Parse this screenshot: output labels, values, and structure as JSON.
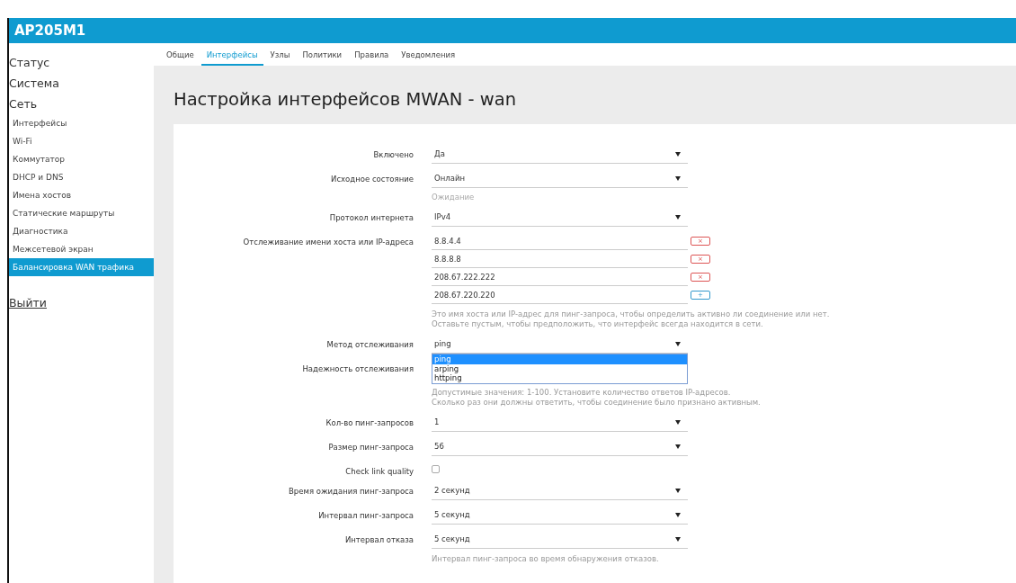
{
  "header": {
    "title": "AP205M1"
  },
  "sidebar": {
    "items": [
      {
        "label": "Статус",
        "selected": false
      },
      {
        "label": "Система",
        "selected": false
      },
      {
        "label": "Сеть",
        "selected": false,
        "children": [
          {
            "label": "Интерфейсы",
            "selected": false
          },
          {
            "label": "Wi-Fi",
            "selected": false
          },
          {
            "label": "Коммутатор",
            "selected": false
          },
          {
            "label": "DHCP и DNS",
            "selected": false
          },
          {
            "label": "Имена хостов",
            "selected": false
          },
          {
            "label": "Статические маршруты",
            "selected": false
          },
          {
            "label": "Диагностика",
            "selected": false
          },
          {
            "label": "Межсетевой экран",
            "selected": false
          },
          {
            "label": "Балансировка WAN трафика",
            "selected": true
          }
        ]
      }
    ],
    "logout": "Выйти"
  },
  "tabs": [
    {
      "label": "Общие",
      "selected": false
    },
    {
      "label": "Интерфейсы",
      "selected": true
    },
    {
      "label": "Узлы",
      "selected": false
    },
    {
      "label": "Политики",
      "selected": false
    },
    {
      "label": "Правила",
      "selected": false
    },
    {
      "label": "Уведомления",
      "selected": false
    }
  ],
  "page_title": "Настройка интерфейсов MWAN - wan",
  "form": {
    "rows": [
      {
        "kind": "select",
        "label": "Включено",
        "value": "Да"
      },
      {
        "kind": "select",
        "label": "Исходное состояние",
        "value": "Онлайн",
        "note": "Ожидание"
      },
      {
        "kind": "select",
        "label": "Протокол интернета",
        "value": "IPv4"
      },
      {
        "kind": "host_list",
        "label": "Отслеживание имени хоста или IP-адреса",
        "entries": [
          {
            "value": "8.8.4.4",
            "button": {
              "kind": "remove",
              "label": "×"
            }
          },
          {
            "value": "8.8.8.8",
            "button": {
              "kind": "remove",
              "label": "×"
            }
          },
          {
            "value": "208.67.222.222",
            "button": {
              "kind": "remove",
              "label": "×"
            }
          },
          {
            "value": "208.67.220.220",
            "button": {
              "kind": "add",
              "label": "+"
            }
          }
        ],
        "hint": [
          "Это имя хоста или IP-адрес для пинг-запроса, чтобы определить активно ли соединение или нет.",
          "Оставьте пустым, чтобы предположить, что интерфейс всегда находится в сети."
        ]
      },
      {
        "kind": "select",
        "label": "Метод отслеживания",
        "value": "ping",
        "expanded": true,
        "options": [
          {
            "label": "ping",
            "selected": true
          },
          {
            "label": "arping",
            "selected": false
          },
          {
            "label": "httping",
            "selected": false
          }
        ]
      },
      {
        "kind": "hidden",
        "label": "Надежность отслеживания",
        "hint": [
          "Допустимые значения: 1-100. Установите количество ответов IP-адресов.",
          "Сколько раз они должны ответить, чтобы соединение было признано активным."
        ]
      },
      {
        "kind": "select",
        "label": "Кол-во пинг-запросов",
        "value": "1"
      },
      {
        "kind": "select",
        "label": "Размер пинг-запроса",
        "value": "56"
      },
      {
        "kind": "checkbox",
        "label": "Check link quality",
        "checked": false
      },
      {
        "kind": "select",
        "label": "Время ожидания пинг-запроса",
        "value": "2 секунд"
      },
      {
        "kind": "select",
        "label": "Интервал пинг-запроса",
        "value": "5 секунд"
      },
      {
        "kind": "select",
        "label": "Интервал отказа",
        "value": "5 секунд",
        "hint": [
          "Интервал пинг-запроса во время обнаружения отказов."
        ]
      }
    ]
  }
}
